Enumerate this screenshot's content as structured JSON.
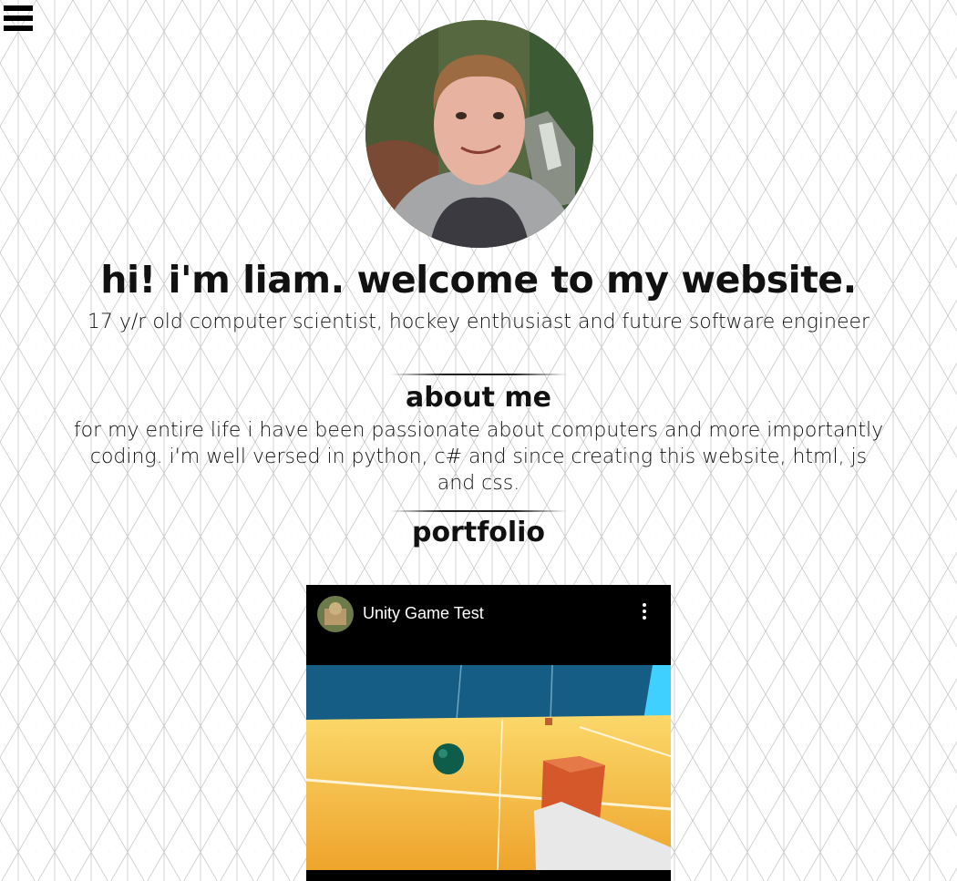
{
  "nav": {
    "menu_icon": "hamburger-menu-icon"
  },
  "profile": {
    "photo_description_icon": "profile-photo"
  },
  "hero": {
    "title": "hi! i'm liam. welcome to my website.",
    "subtitle": "17 y/r old computer scientist, hockey enthusiast and future software engineer"
  },
  "about": {
    "heading": "about me",
    "text": "for my entire life i have been passionate about computers and more importantly coding. i'm well versed in python, c# and since creating this website, html, js and css."
  },
  "portfolio": {
    "heading": "portfolio",
    "video": {
      "title": "Unity Game Test",
      "more_icon": "more-vertical-icon"
    }
  },
  "colors": {
    "background": "#ffffff",
    "grid_lines": "#c8c8c8",
    "text": "#111111",
    "video_bg": "#000000",
    "scene_sky": "#155d84",
    "scene_floor": "#f5b936",
    "scene_cube": "#d4582a",
    "scene_ball": "#0e5c4a"
  }
}
